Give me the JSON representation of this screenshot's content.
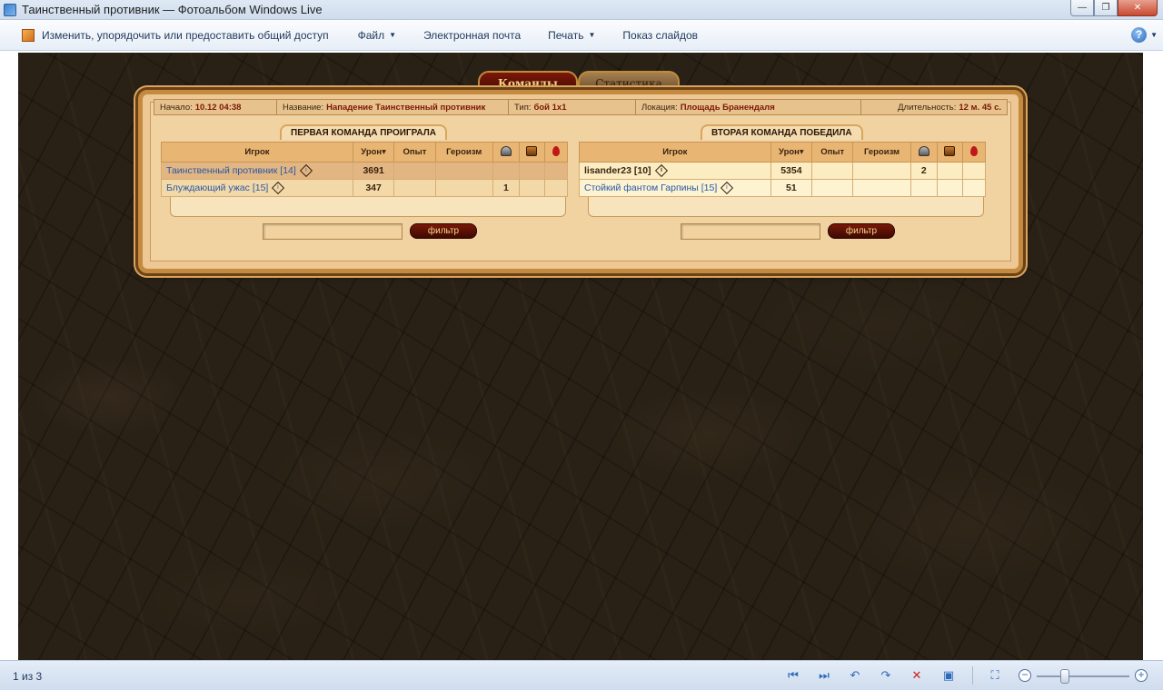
{
  "window": {
    "title": "Таинственный противник — Фотоальбом Windows Live",
    "buttons": {
      "minimize": "—",
      "restore": "❐",
      "close": "✕"
    }
  },
  "menu": {
    "items": [
      {
        "label": "Изменить, упорядочить или предоставить общий доступ",
        "icon": "edit-icon"
      },
      {
        "label": "Файл",
        "dropdown": true
      },
      {
        "label": "Электронная почта"
      },
      {
        "label": "Печать",
        "dropdown": true
      },
      {
        "label": "Показ слайдов"
      }
    ],
    "help": "?"
  },
  "game": {
    "tabs": {
      "active": "Команды",
      "inactive": "Статистика"
    },
    "info": {
      "start_label": "Начало:",
      "start_value": "10.12 04:38",
      "name_label": "Название:",
      "name_value": "Нападение Таинственный противник",
      "type_label": "Тип:",
      "type_value": "бой 1х1",
      "location_label": "Локация:",
      "location_value": "Площадь Бранендаля",
      "duration_label": "Длительность:",
      "duration_value": "12 м. 45 с."
    },
    "columns": {
      "player": "Игрок",
      "damage": "Урон▾",
      "exp": "Опыт",
      "heroism": "Героизм"
    },
    "team1": {
      "label": "ПЕРВАЯ КОМАНДА ПРОИГРАЛА",
      "rows": [
        {
          "name": "Таинственный противник [14]",
          "damage": "3691",
          "exp": "",
          "heroism": "",
          "c1": "",
          "c2": "",
          "c3": ""
        },
        {
          "name": "Блуждающий ужас [15]",
          "damage": "347",
          "exp": "",
          "heroism": "",
          "c1": "1",
          "c2": "",
          "c3": ""
        }
      ]
    },
    "team2": {
      "label": "ВТОРАЯ КОМАНДА ПОБЕДИЛА",
      "rows": [
        {
          "name": "lisander23 [10]",
          "damage": "5354",
          "exp": "",
          "heroism": "",
          "c1": "2",
          "c2": "",
          "c3": ""
        },
        {
          "name": "Стойкий фантом Гарпины [15]",
          "damage": "51",
          "exp": "",
          "heroism": "",
          "c1": "",
          "c2": "",
          "c3": ""
        }
      ]
    },
    "filter_label": "фильтр"
  },
  "statusbar": {
    "counter": "1 из 3",
    "zoom_level": 0.25
  },
  "colors": {
    "accent": "#7a1808",
    "panel": "#eec894",
    "link": "#2858a8"
  }
}
